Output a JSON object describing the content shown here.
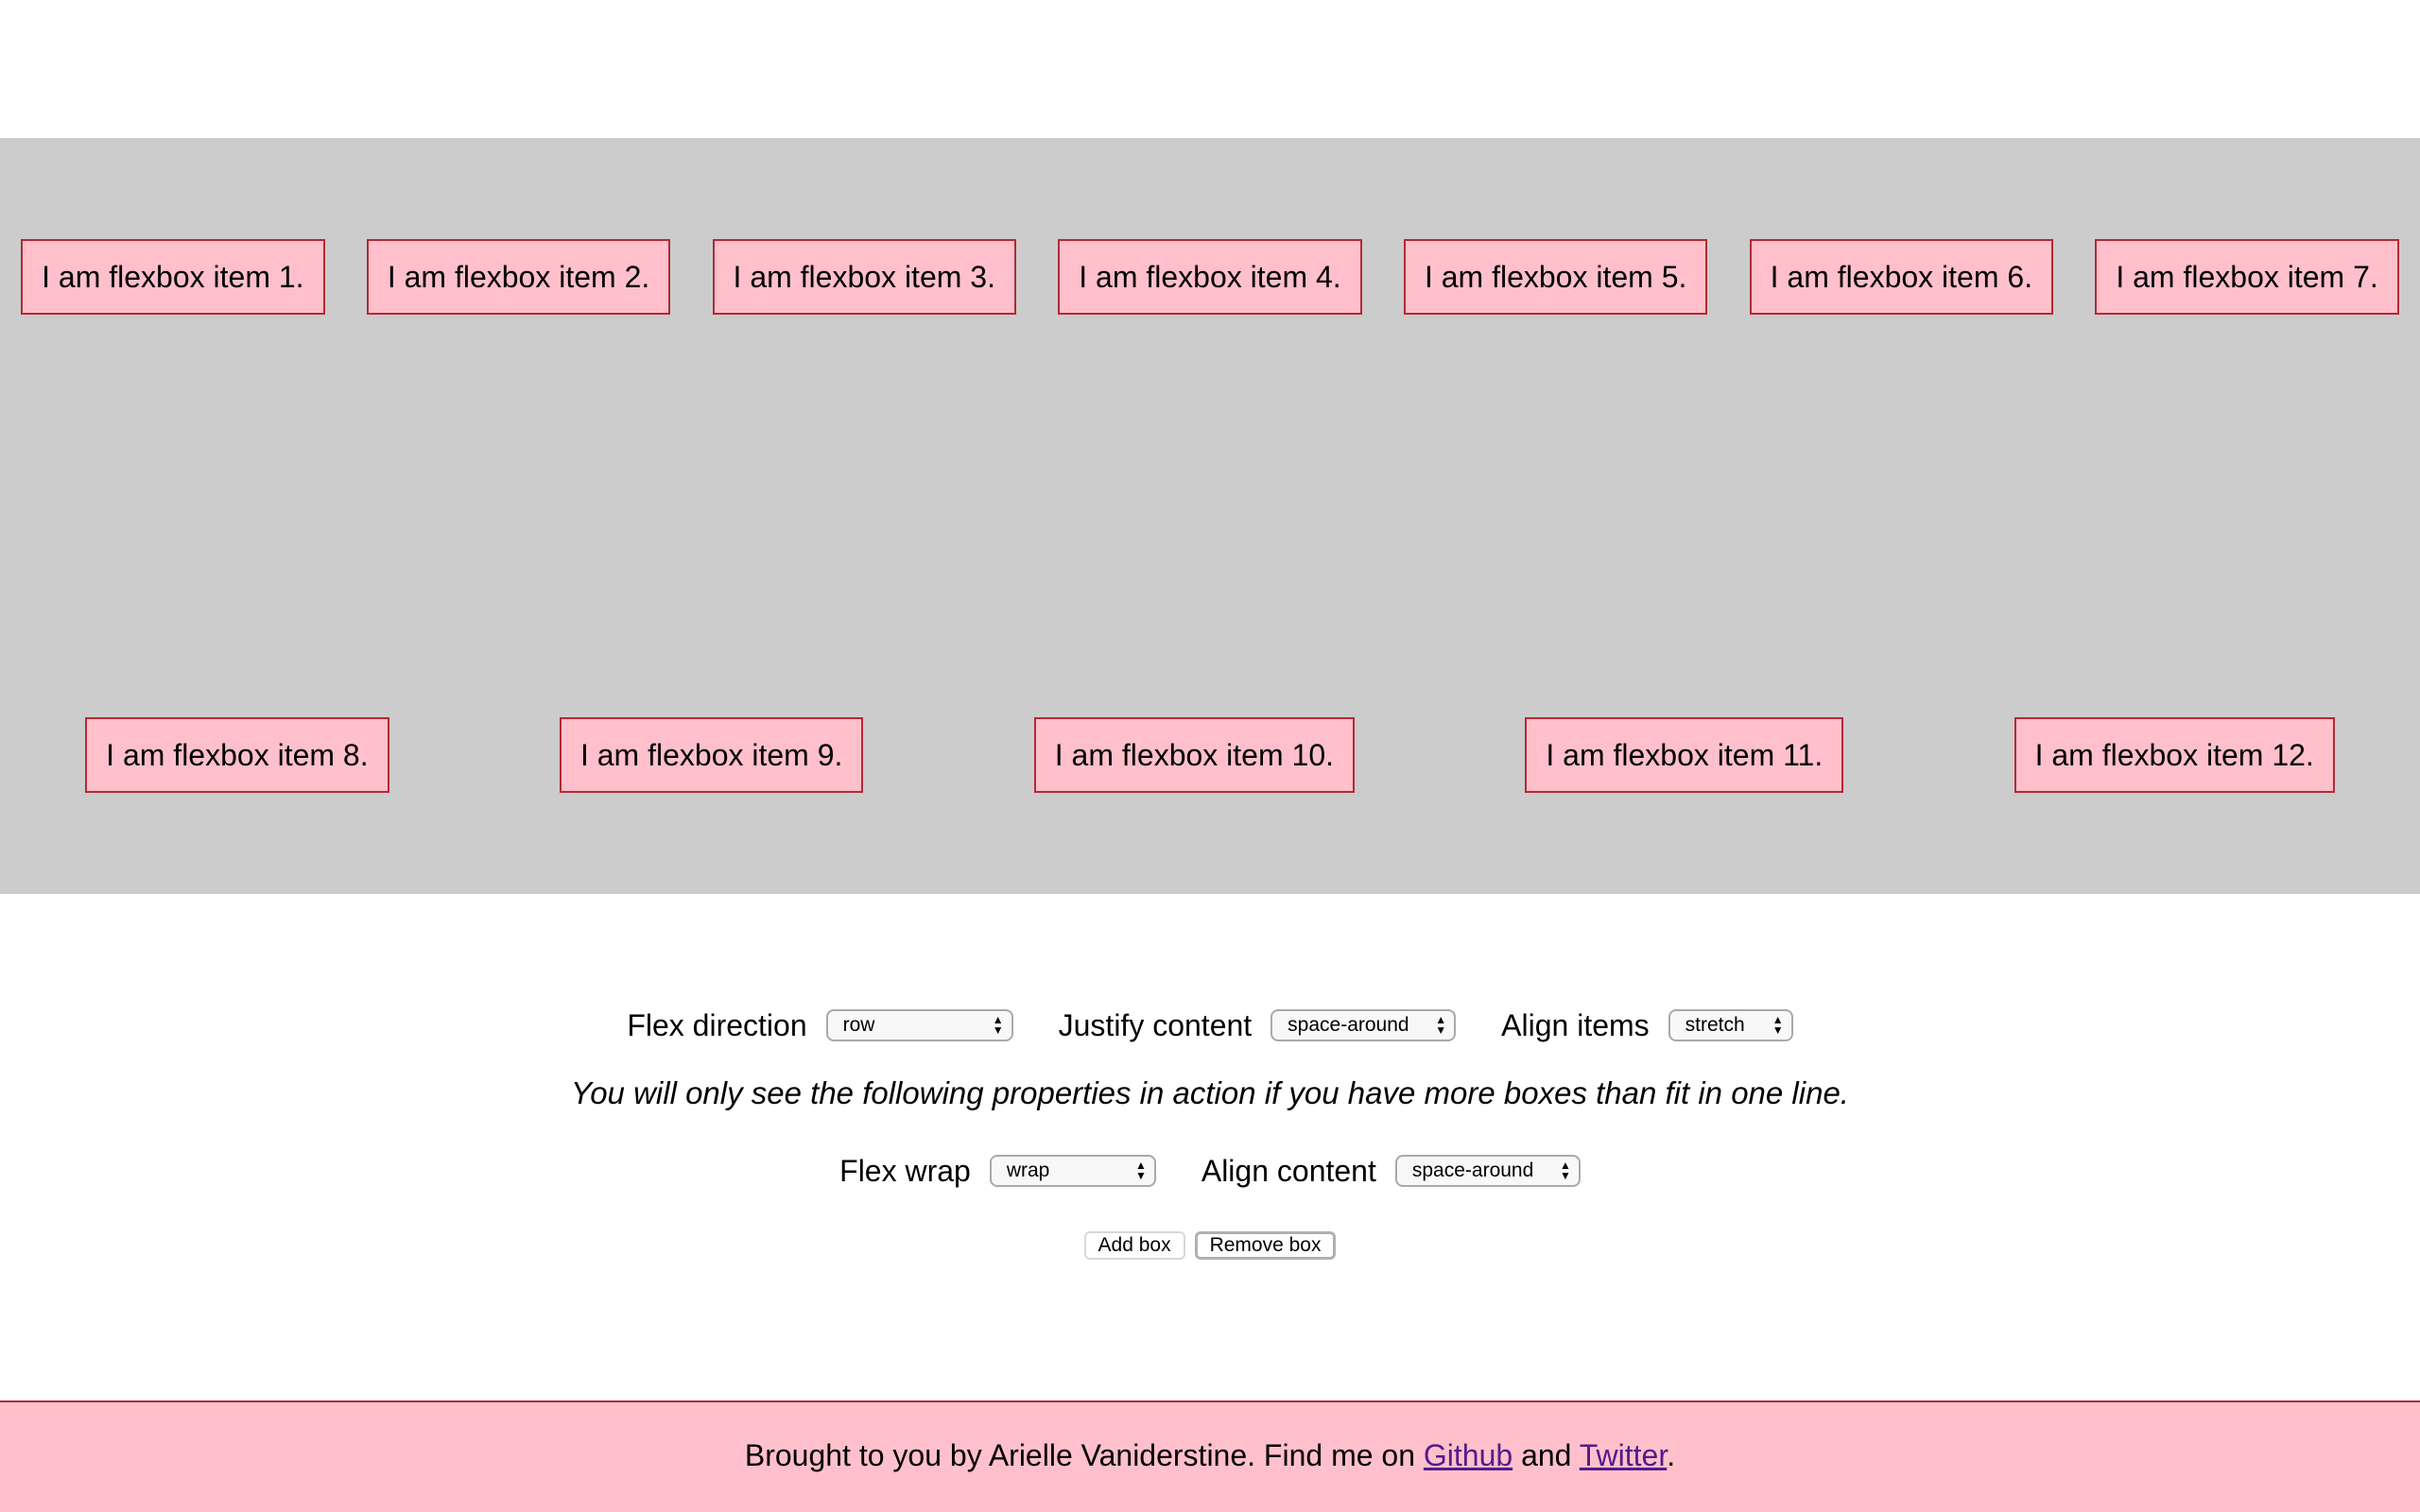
{
  "flex_container": {
    "background": "#cccccc",
    "items": [
      "I am flexbox item 1.",
      "I am flexbox item 2.",
      "I am flexbox item 3.",
      "I am flexbox item 4.",
      "I am flexbox item 5.",
      "I am flexbox item 6.",
      "I am flexbox item 7.",
      "I am flexbox item 8.",
      "I am flexbox item 9.",
      "I am flexbox item 10.",
      "I am flexbox item 11.",
      "I am flexbox item 12."
    ],
    "item_background": "#ffc0cb",
    "item_border": "#b22a34"
  },
  "controls": {
    "flex_direction": {
      "label": "Flex direction",
      "value": "row"
    },
    "justify_content": {
      "label": "Justify content",
      "value": "space-around"
    },
    "align_items": {
      "label": "Align items",
      "value": "stretch"
    },
    "note": "You will only see the following properties in action if you have more boxes than fit in one line.",
    "flex_wrap": {
      "label": "Flex wrap",
      "value": "wrap"
    },
    "align_content": {
      "label": "Align content",
      "value": "space-around"
    },
    "add_box": "Add box",
    "remove_box": "Remove box"
  },
  "footer": {
    "text_before": "Brought to you by Arielle Vaniderstine. Find me on ",
    "github": "Github",
    "text_middle": " and ",
    "twitter": "Twitter",
    "text_after": "."
  }
}
